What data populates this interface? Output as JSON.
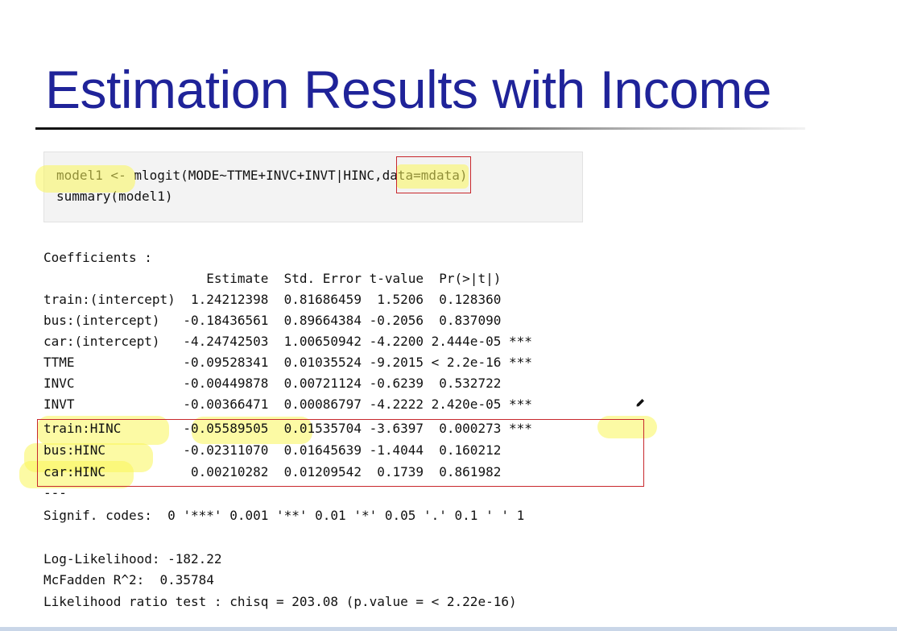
{
  "slide": {
    "title": "Estimation Results with Income"
  },
  "code": {
    "line1": "model1 <- mlogit(MODE~TTME+INVC+INVT|HINC,data=mdata)",
    "line2": "summary(model1)"
  },
  "output": {
    "coefficients_label": "Coefficients :",
    "header": "                     Estimate  Std. Error t-value  Pr(>|t|)",
    "rows": [
      "train:(intercept)  1.24212398  0.81686459  1.5206  0.128360",
      "bus:(intercept)   -0.18436561  0.89664384 -0.2056  0.837090",
      "car:(intercept)   -4.24742503  1.00650942 -4.2200 2.444e-05 ***",
      "TTME              -0.09528341  0.01035524 -9.2015 < 2.2e-16 ***",
      "INVC              -0.00449878  0.00721124 -0.6239  0.532722",
      "INVT              -0.00366471  0.00086797 -4.2222 2.420e-05 ***",
      "train:HINC        -0.05589505  0.01535704 -3.6397  0.000273 ***",
      "bus:HINC          -0.02311070  0.01645639 -1.4044  0.160212",
      "car:HINC           0.00210282  0.01209542  0.1739  0.861982"
    ],
    "separator": "---",
    "signif": "Signif. codes:  0 '***' 0.001 '**' 0.01 '*' 0.05 '.' 0.1 ' ' 1",
    "loglik": "Log-Likelihood: -182.22",
    "mcfadden": "McFadden R^2:  0.35784",
    "lrtest": "Likelihood ratio test : chisq = 203.08 (p.value = < 2.22e-16)"
  },
  "colors": {
    "title": "#1f2399",
    "highlight": "#faf55a",
    "annotation_box": "#c8282d"
  },
  "icons": {
    "annotation": "pen-icon"
  }
}
